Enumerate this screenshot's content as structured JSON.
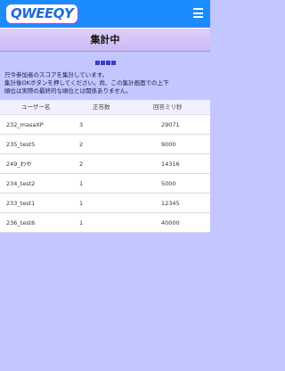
{
  "header": {
    "logo_text": "QWEEQY",
    "menu_icon": "hamburger-icon",
    "bar_color": "#1a8cff"
  },
  "page": {
    "title": "集計中"
  },
  "message": {
    "lines": [
      "只今参加者のスコアを集計しています。",
      "集計後OKボタンを押してください。尚、この集計画面での上下",
      "順位は実際の最終的な順位とは関係ありません。"
    ]
  },
  "table": {
    "columns": [
      "ユーザー名",
      "正答数",
      "回答ミリ秒"
    ],
    "rows": [
      {
        "user": "232_masaXP",
        "correct": "3",
        "ms": "29071"
      },
      {
        "user": "235_test5",
        "correct": "2",
        "ms": "9000"
      },
      {
        "user": "249_わや",
        "correct": "2",
        "ms": "14316"
      },
      {
        "user": "234_test2",
        "correct": "1",
        "ms": "5000"
      },
      {
        "user": "233_test1",
        "correct": "1",
        "ms": "12345"
      },
      {
        "user": "236_test6",
        "correct": "1",
        "ms": "40000"
      }
    ]
  },
  "colors": {
    "background": "#c3c6ff",
    "accent": "#3a3dd1"
  }
}
